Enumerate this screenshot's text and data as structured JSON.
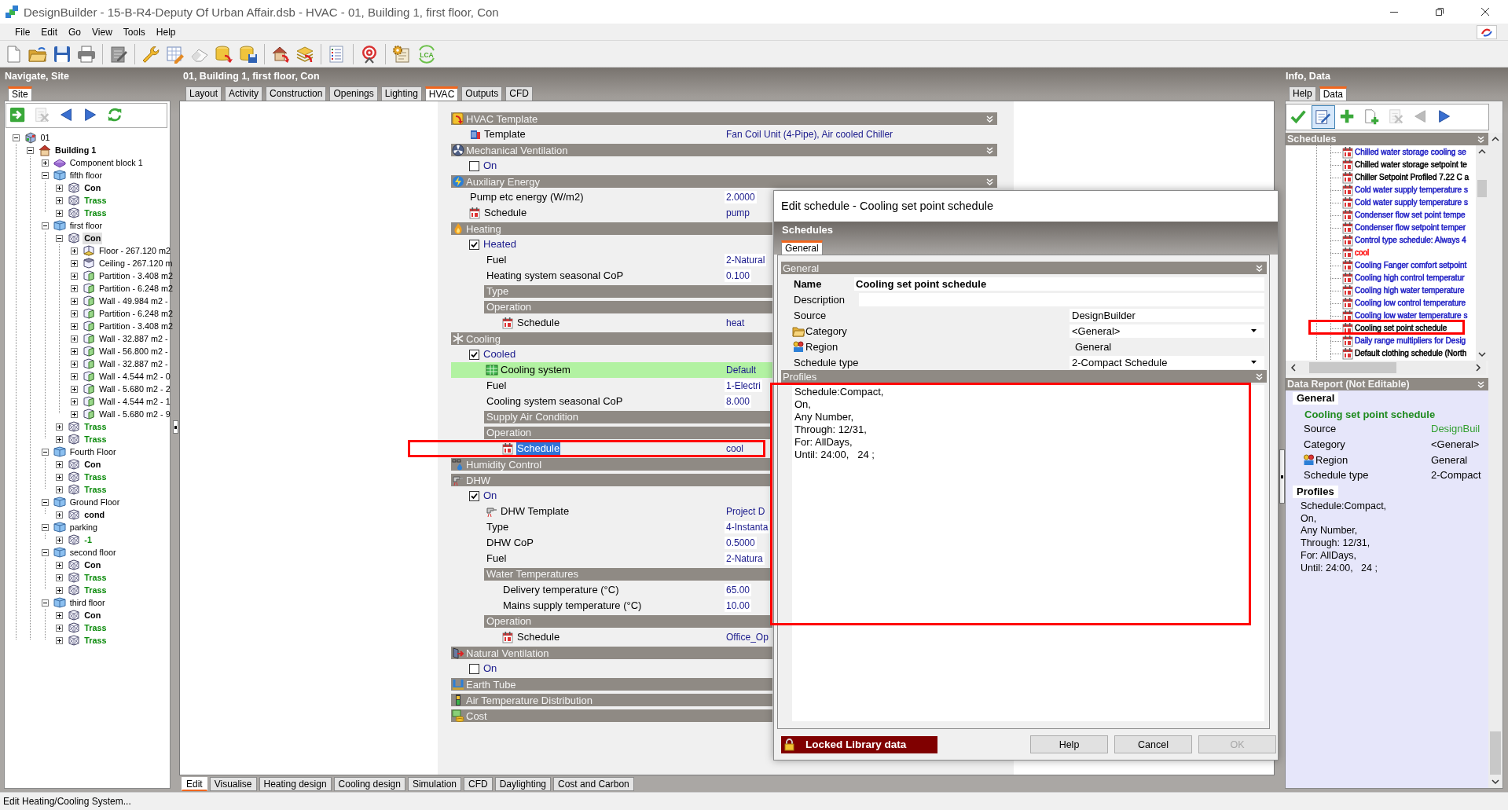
{
  "window": {
    "title": "DesignBuilder - 15-B-R4-Deputy Of Urban Affair.dsb - HVAC - 01, Building 1, first floor, Con"
  },
  "menu": [
    "File",
    "Edit",
    "Go",
    "View",
    "Tools",
    "Help"
  ],
  "main_toolbar": {
    "lca_label": "LCA"
  },
  "navigator": {
    "title": "Navigate, Site",
    "tabs": [
      {
        "label": "Site",
        "selected": true
      }
    ],
    "toolbar": [
      {
        "disabled": false
      },
      {
        "disabled": true
      },
      {
        "disabled": false
      },
      {
        "disabled": false
      },
      {
        "disabled": false
      }
    ],
    "tree": [
      {
        "label": "01",
        "kind": "site",
        "expanded": true,
        "selected": false,
        "children": [
          {
            "label": "Building 1",
            "kind": "building",
            "expanded": true,
            "selected": false,
            "children": [
              {
                "label": "Component block 1",
                "kind": "component",
                "expanded": false,
                "selected": false
              },
              {
                "label": "fifth floor",
                "kind": "block",
                "expanded": true,
                "selected": false,
                "children": [
                  {
                    "label": "Con",
                    "kind": "zone",
                    "color": "#000000",
                    "expanded": false,
                    "selected": false
                  },
                  {
                    "label": "Trass",
                    "kind": "zone",
                    "color": "#0a8a0a",
                    "expanded": false,
                    "selected": false
                  },
                  {
                    "label": "Trass",
                    "kind": "zone",
                    "color": "#0a8a0a",
                    "expanded": false,
                    "selected": false
                  }
                ]
              },
              {
                "label": "first floor",
                "kind": "block",
                "expanded": true,
                "selected": false,
                "children": [
                  {
                    "label": "Con",
                    "kind": "zone",
                    "color": "#000000",
                    "expanded": true,
                    "selected": true,
                    "children": [
                      {
                        "label": "Floor - 267.120 m2",
                        "kind": "floor",
                        "expanded": false,
                        "selected": false
                      },
                      {
                        "label": "Ceiling - 267.120 m",
                        "kind": "ceiling",
                        "expanded": false,
                        "selected": false
                      },
                      {
                        "label": "Partition - 3.408 m2",
                        "kind": "wall",
                        "expanded": false,
                        "selected": false
                      },
                      {
                        "label": "Partition - 6.248 m2",
                        "kind": "wall",
                        "expanded": false,
                        "selected": false
                      },
                      {
                        "label": "Wall - 49.984 m2 -",
                        "kind": "wall",
                        "expanded": false,
                        "selected": false
                      },
                      {
                        "label": "Partition - 6.248 m2",
                        "kind": "wall",
                        "expanded": false,
                        "selected": false
                      },
                      {
                        "label": "Partition - 3.408 m2",
                        "kind": "wall",
                        "expanded": false,
                        "selected": false
                      },
                      {
                        "label": "Wall - 32.887 m2 -",
                        "kind": "wall",
                        "expanded": false,
                        "selected": false
                      },
                      {
                        "label": "Wall - 56.800 m2 -",
                        "kind": "wall",
                        "expanded": false,
                        "selected": false
                      },
                      {
                        "label": "Wall - 32.887 m2 -",
                        "kind": "wall",
                        "expanded": false,
                        "selected": false
                      },
                      {
                        "label": "Wall - 4.544 m2 - 0",
                        "kind": "wall",
                        "expanded": false,
                        "selected": false
                      },
                      {
                        "label": "Wall - 5.680 m2 - 2",
                        "kind": "wall",
                        "expanded": false,
                        "selected": false
                      },
                      {
                        "label": "Wall - 4.544 m2 - 1",
                        "kind": "wall",
                        "expanded": false,
                        "selected": false
                      },
                      {
                        "label": "Wall - 5.680 m2 - 9",
                        "kind": "wall",
                        "expanded": false,
                        "selected": false
                      }
                    ]
                  },
                  {
                    "label": "Trass",
                    "kind": "zone",
                    "color": "#0a8a0a",
                    "expanded": false,
                    "selected": false
                  },
                  {
                    "label": "Trass",
                    "kind": "zone",
                    "color": "#0a8a0a",
                    "expanded": false,
                    "selected": false
                  }
                ]
              },
              {
                "label": "Fourth Floor",
                "kind": "block",
                "expanded": true,
                "selected": false,
                "children": [
                  {
                    "label": "Con",
                    "kind": "zone",
                    "color": "#000000",
                    "expanded": false,
                    "selected": false
                  },
                  {
                    "label": "Trass",
                    "kind": "zone",
                    "color": "#0a8a0a",
                    "expanded": false,
                    "selected": false
                  },
                  {
                    "label": "Trass",
                    "kind": "zone",
                    "color": "#0a8a0a",
                    "expanded": false,
                    "selected": false
                  }
                ]
              },
              {
                "label": "Ground Floor",
                "kind": "block",
                "expanded": true,
                "selected": false,
                "children": [
                  {
                    "label": "cond",
                    "kind": "zone",
                    "color": "#000000",
                    "expanded": false,
                    "selected": false
                  }
                ]
              },
              {
                "label": "parking",
                "kind": "block",
                "expanded": true,
                "selected": false,
                "children": [
                  {
                    "label": "-1",
                    "kind": "zone",
                    "color": "#0a8a0a",
                    "expanded": false,
                    "selected": false
                  }
                ]
              },
              {
                "label": "second floor",
                "kind": "block",
                "expanded": true,
                "selected": false,
                "children": [
                  {
                    "label": "Con",
                    "kind": "zone",
                    "color": "#000000",
                    "expanded": false,
                    "selected": false
                  },
                  {
                    "label": "Trass",
                    "kind": "zone",
                    "color": "#0a8a0a",
                    "expanded": false,
                    "selected": false
                  },
                  {
                    "label": "Trass",
                    "kind": "zone",
                    "color": "#0a8a0a",
                    "expanded": false,
                    "selected": false
                  }
                ]
              },
              {
                "label": "third floor",
                "kind": "block",
                "expanded": true,
                "selected": false,
                "children": [
                  {
                    "label": "Con",
                    "kind": "zone",
                    "color": "#000000",
                    "expanded": false,
                    "selected": false
                  },
                  {
                    "label": "Trass",
                    "kind": "zone",
                    "color": "#0a8a0a",
                    "expanded": false,
                    "selected": false
                  },
                  {
                    "label": "Trass",
                    "kind": "zone",
                    "color": "#0a8a0a",
                    "expanded": false,
                    "selected": false
                  }
                ]
              }
            ]
          }
        ]
      }
    ]
  },
  "editor": {
    "title": "01, Building 1, first floor, Con",
    "tabs": [
      {
        "label": "Layout",
        "selected": false
      },
      {
        "label": "Activity",
        "selected": false
      },
      {
        "label": "Construction",
        "selected": false
      },
      {
        "label": "Openings",
        "selected": false
      },
      {
        "label": "Lighting",
        "selected": false
      },
      {
        "label": "HVAC",
        "selected": true
      },
      {
        "label": "Outputs",
        "selected": false
      },
      {
        "label": "CFD",
        "selected": false
      }
    ],
    "sections": [
      {
        "title": "HVAC Template",
        "expanded": true,
        "children": [
          {
            "kind": "equipment",
            "label": "Template",
            "value": "Fan Coil Unit (4-Pipe), Air cooled Chiller",
            "selected": false
          }
        ]
      },
      {
        "title": "Mechanical Ventilation",
        "expanded": true,
        "children": [
          {
            "kind": "check",
            "label": "On",
            "checked": false,
            "selected": false
          }
        ]
      },
      {
        "title": "Auxiliary Energy",
        "expanded": true,
        "children": [
          {
            "kind": "field",
            "label": "Pump etc energy (W/m2)",
            "value": "2.0000",
            "selected": false
          },
          {
            "kind": "schedule",
            "label": "Schedule",
            "value": "pump",
            "selected": false
          }
        ]
      },
      {
        "title": "Heating",
        "children": [
          {
            "kind": "check",
            "label": "Heated",
            "checked": true,
            "selected": false,
            "children": [
              {
                "kind": "field",
                "label": "Fuel",
                "value": "2-Natural",
                "selected": false
              },
              {
                "kind": "field",
                "label": "Heating system seasonal CoP",
                "value": "0.100",
                "selected": false
              },
              {
                "kind": "group",
                "title": "Type"
              },
              {
                "kind": "group",
                "title": "Operation",
                "children": [
                  {
                    "kind": "schedule",
                    "label": "Schedule",
                    "value": "heat",
                    "selected": false
                  }
                ]
              }
            ]
          }
        ]
      },
      {
        "title": "Cooling",
        "children": [
          {
            "kind": "check",
            "label": "Cooled",
            "checked": true,
            "selected": false,
            "children": [
              {
                "kind": "system",
                "label": "Cooling system",
                "value": "Default",
                "selected": false,
                "highlighted": true
              },
              {
                "kind": "field",
                "label": "Fuel",
                "value": "1-Electri",
                "selected": false
              },
              {
                "kind": "field",
                "label": "Cooling system seasonal CoP",
                "value": "8.000",
                "selected": false
              },
              {
                "kind": "group",
                "title": "Supply Air Condition"
              },
              {
                "kind": "group",
                "title": "Operation",
                "children": [
                  {
                    "kind": "schedule",
                    "label": "Schedule",
                    "value": "cool",
                    "selected": true,
                    "outlined": true
                  }
                ]
              }
            ]
          }
        ]
      },
      {
        "title": "Humidity Control"
      },
      {
        "title": "DHW",
        "children": [
          {
            "kind": "check",
            "label": "On",
            "checked": true,
            "selected": false,
            "children": [
              {
                "kind": "dhw",
                "label": "DHW Template",
                "value": "Project D",
                "selected": false
              },
              {
                "kind": "field",
                "label": "Type",
                "value": "4-Instanta",
                "selected": false
              },
              {
                "kind": "field",
                "label": "DHW CoP",
                "value": "0.5000",
                "selected": false
              },
              {
                "kind": "field",
                "label": "Fuel",
                "value": "2-Natura",
                "selected": false
              },
              {
                "kind": "group",
                "title": "Water Temperatures",
                "children": [
                  {
                    "kind": "field",
                    "label": "Delivery temperature (°C)",
                    "value": "65.00",
                    "selected": false
                  },
                  {
                    "kind": "field",
                    "label": "Mains supply temperature (°C)",
                    "value": "10.00",
                    "selected": false
                  }
                ]
              },
              {
                "kind": "group",
                "title": "Operation",
                "children": [
                  {
                    "kind": "schedule",
                    "label": "Schedule",
                    "value": "Office_Op",
                    "selected": false
                  }
                ]
              }
            ]
          }
        ]
      },
      {
        "title": "Natural Ventilation",
        "children": [
          {
            "kind": "check",
            "label": "On",
            "checked": false,
            "selected": false
          }
        ]
      },
      {
        "title": "Earth Tube"
      },
      {
        "title": "Air Temperature Distribution"
      },
      {
        "title": "Cost"
      }
    ],
    "bottom_tabs": [
      {
        "label": "Edit",
        "selected": true
      },
      {
        "label": "Visualise",
        "selected": false
      },
      {
        "label": "Heating design",
        "selected": false
      },
      {
        "label": "Cooling design",
        "selected": false
      },
      {
        "label": "Simulation",
        "selected": false
      },
      {
        "label": "CFD",
        "selected": false
      },
      {
        "label": "Daylighting",
        "selected": false
      },
      {
        "label": "Cost and Carbon",
        "selected": false
      }
    ]
  },
  "dialog": {
    "title": "Edit schedule - Cooling set point schedule",
    "heading": "Schedules",
    "tabs": [
      {
        "label": "General",
        "selected": true
      }
    ],
    "general": {
      "title": "General",
      "expanded": true,
      "fields": [
        {
          "kind": "name",
          "label": "Name",
          "value": "Cooling set point schedule"
        },
        {
          "kind": "memo",
          "label": "Description"
        },
        {
          "kind": "text",
          "label": "Source",
          "value": "DesignBuilder"
        },
        {
          "kind": "dropdown",
          "label": "Category",
          "value": "<General>"
        },
        {
          "kind": "static",
          "label": "Region",
          "value": "General"
        },
        {
          "kind": "dropdown",
          "label": "Schedule type",
          "value": "2-Compact Schedule"
        }
      ]
    },
    "profiles": {
      "title": "Profiles",
      "expanded": true,
      "outlined": true,
      "text": "Schedule:Compact,\nOn,\nAny Number,\nThrough: 12/31,\nFor: AllDays,\nUntil: 24:00,   24 ;"
    },
    "lock_notice": "Locked Library data",
    "buttons": [
      {
        "label": "Help",
        "disabled": false
      },
      {
        "label": "Cancel",
        "disabled": false
      },
      {
        "label": "OK",
        "disabled": true
      }
    ]
  },
  "info": {
    "title": "Info, Data",
    "tabs": [
      {
        "label": "Help",
        "selected": false
      },
      {
        "label": "Data",
        "selected": true
      }
    ],
    "toolbar": [
      {
        "disabled": false,
        "selected": false
      },
      {
        "disabled": false,
        "selected": true
      },
      {
        "disabled": false,
        "selected": false
      },
      {
        "disabled": false,
        "selected": false
      },
      {
        "disabled": true,
        "selected": false
      },
      {
        "disabled": true,
        "selected": false
      },
      {
        "disabled": false,
        "selected": false
      }
    ],
    "schedules": {
      "title": "Schedules",
      "expanded": true,
      "items": [
        {
          "label": "Chilled water storage cooling se",
          "color": "#1c1cc4",
          "selected": false
        },
        {
          "label": "Chilled water storage setpoint te",
          "color": "#000000",
          "selected": false
        },
        {
          "label": "Chiller Setpoint Profiled 7.22 C a",
          "color": "#000000",
          "selected": false
        },
        {
          "label": "Cold water supply temperature s",
          "color": "#1c1cc4",
          "selected": false
        },
        {
          "label": "Cold water supply temperature s",
          "color": "#1c1cc4",
          "selected": false
        },
        {
          "label": "Condenser flow set point tempe",
          "color": "#1c1cc4",
          "selected": false
        },
        {
          "label": "Condenser flow setpoint temper",
          "color": "#1c1cc4",
          "selected": false
        },
        {
          "label": "Control type schedule: Always 4",
          "color": "#1c1cc4",
          "selected": false
        },
        {
          "label": "cool",
          "color": "#ff0000",
          "selected": false
        },
        {
          "label": "Cooling Fanger comfort setpoint",
          "color": "#1c1cc4",
          "selected": false
        },
        {
          "label": "Cooling high control temperatur",
          "color": "#1c1cc4",
          "selected": false
        },
        {
          "label": "Cooling high water temperature",
          "color": "#1c1cc4",
          "selected": false
        },
        {
          "label": "Cooling low control temperature",
          "color": "#1c1cc4",
          "selected": false
        },
        {
          "label": "Cooling low water temperature s",
          "color": "#1c1cc4",
          "selected": false
        },
        {
          "label": "Cooling set point schedule",
          "color": "#000000",
          "selected": false,
          "outlined": true
        },
        {
          "label": "Daily range multipliers for Desig",
          "color": "#1c1cc4",
          "selected": false
        },
        {
          "label": "Default clothing schedule (North",
          "color": "#000000",
          "selected": false
        }
      ]
    },
    "report": {
      "title": "Data Report (Not Editable)",
      "expanded": true,
      "general_heading": "General",
      "name": "Cooling set point schedule",
      "rows": [
        {
          "label": "Source",
          "value": "DesignBuil",
          "color": "#33a033"
        },
        {
          "label": "Category",
          "value": "<General>",
          "color": "#000000"
        },
        {
          "label": "Region",
          "value": "General",
          "color": "#000000"
        },
        {
          "label": "Schedule type",
          "value": "2-Compact",
          "color": "#000000"
        }
      ],
      "profiles_heading": "Profiles",
      "profile_text": "Schedule:Compact,\nOn,\nAny Number,\nThrough: 12/31,\nFor: AllDays,\nUntil: 24:00,   24 ;"
    }
  },
  "status_bar": "Edit Heating/Cooling System..."
}
